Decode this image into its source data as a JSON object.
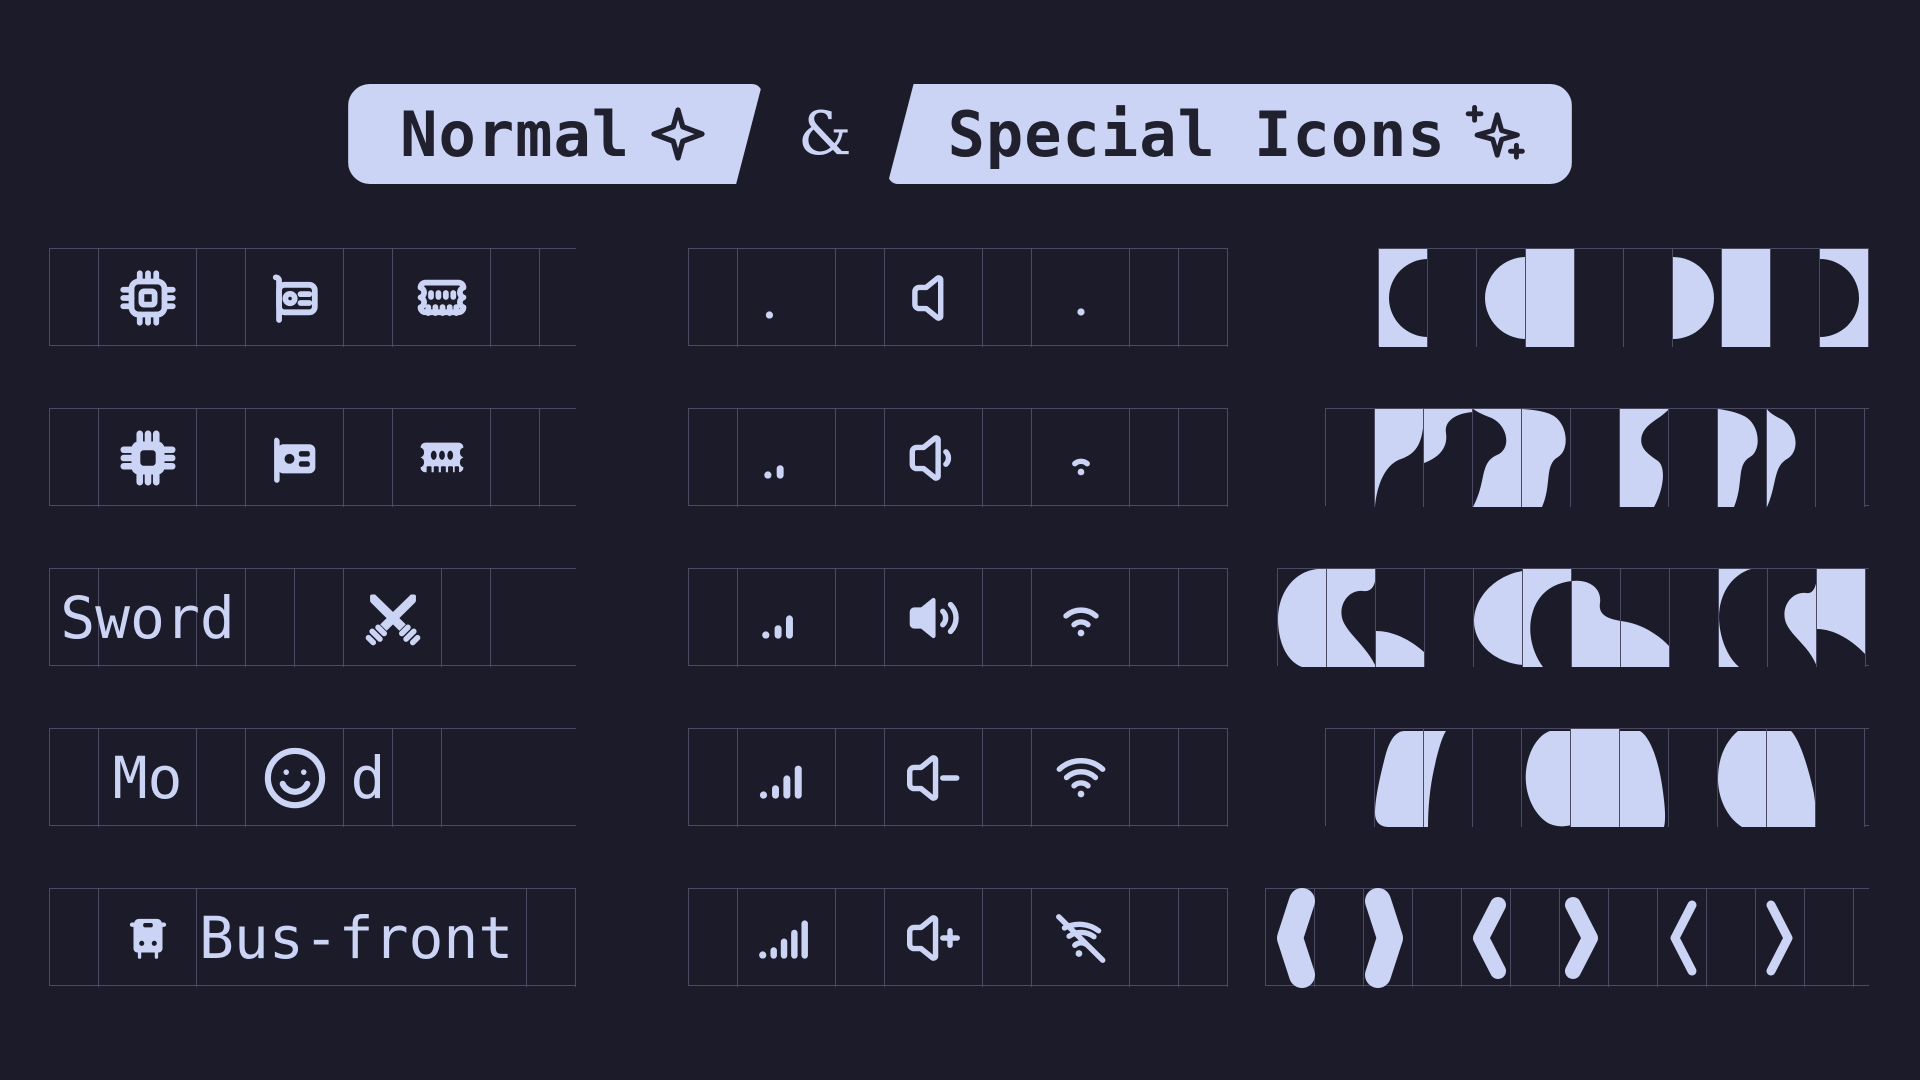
{
  "header": {
    "left_pill": {
      "label": "Normal",
      "icon": "sparkle-four-point-icon"
    },
    "separator": "&",
    "right_pill": {
      "label": "Special Icons",
      "icon": "sparkles-plus-icon"
    }
  },
  "theme": {
    "background": "#1c1b29",
    "accent": "#ccd4f5",
    "grid_line": "#4a4a63",
    "text_on_accent": "#21202f"
  },
  "columns": {
    "normal_icons": {
      "name": "normal-icons-column",
      "rows": [
        {
          "name": "hardware-outline-row",
          "items": [
            {
              "label": "",
              "icon": "cpu-icon",
              "style": "outline"
            },
            {
              "label": "",
              "icon": "device-card-icon",
              "style": "outline"
            },
            {
              "label": "",
              "icon": "ram-memory-icon",
              "style": "outline"
            }
          ]
        },
        {
          "name": "hardware-filled-row",
          "items": [
            {
              "label": "",
              "icon": "cpu-icon",
              "style": "filled"
            },
            {
              "label": "",
              "icon": "device-card-icon",
              "style": "filled"
            },
            {
              "label": "",
              "icon": "ram-memory-icon",
              "style": "filled"
            }
          ]
        },
        {
          "name": "sword-row",
          "text": "Sword",
          "trailing_icon": "crossed-swords-icon"
        },
        {
          "name": "mood-row",
          "text_before": "Mo",
          "inline_icon": "mood-smile-icon",
          "text_after": "d"
        },
        {
          "name": "bus-front-row",
          "leading_icon": "bus-front-icon",
          "text": "Bus-front"
        }
      ]
    },
    "status_icons": {
      "name": "status-icons-column",
      "rows": [
        {
          "name": "status-level-0",
          "signal": "signal-0-icon",
          "volume": "volume-off-icon",
          "wifi": "wifi-0-icon"
        },
        {
          "name": "status-level-1",
          "signal": "signal-1-icon",
          "volume": "volume-low-icon",
          "wifi": "wifi-1-icon"
        },
        {
          "name": "status-level-2",
          "signal": "signal-2-icon",
          "volume": "volume-high-icon",
          "wifi": "wifi-3-icon"
        },
        {
          "name": "status-level-3",
          "signal": "signal-3-icon",
          "volume": "volume-minus-icon",
          "wifi": "wifi-4-icon"
        },
        {
          "name": "status-level-4",
          "signal": "signal-4-icon",
          "volume": "volume-plus-icon",
          "wifi": "wifi-off-icon"
        }
      ]
    },
    "special_shapes": {
      "name": "special-shapes-column",
      "rows": [
        {
          "name": "half-circle-row",
          "shape": "half-circle-shapes"
        },
        {
          "name": "wave-puzzle-row",
          "shape": "wave-puzzle-shapes"
        },
        {
          "name": "wave-large-row",
          "shape": "wave-large-shapes"
        },
        {
          "name": "blob-row",
          "shape": "blob-shapes"
        },
        {
          "name": "chevron-row",
          "shape": "chevron-shapes"
        }
      ]
    }
  }
}
